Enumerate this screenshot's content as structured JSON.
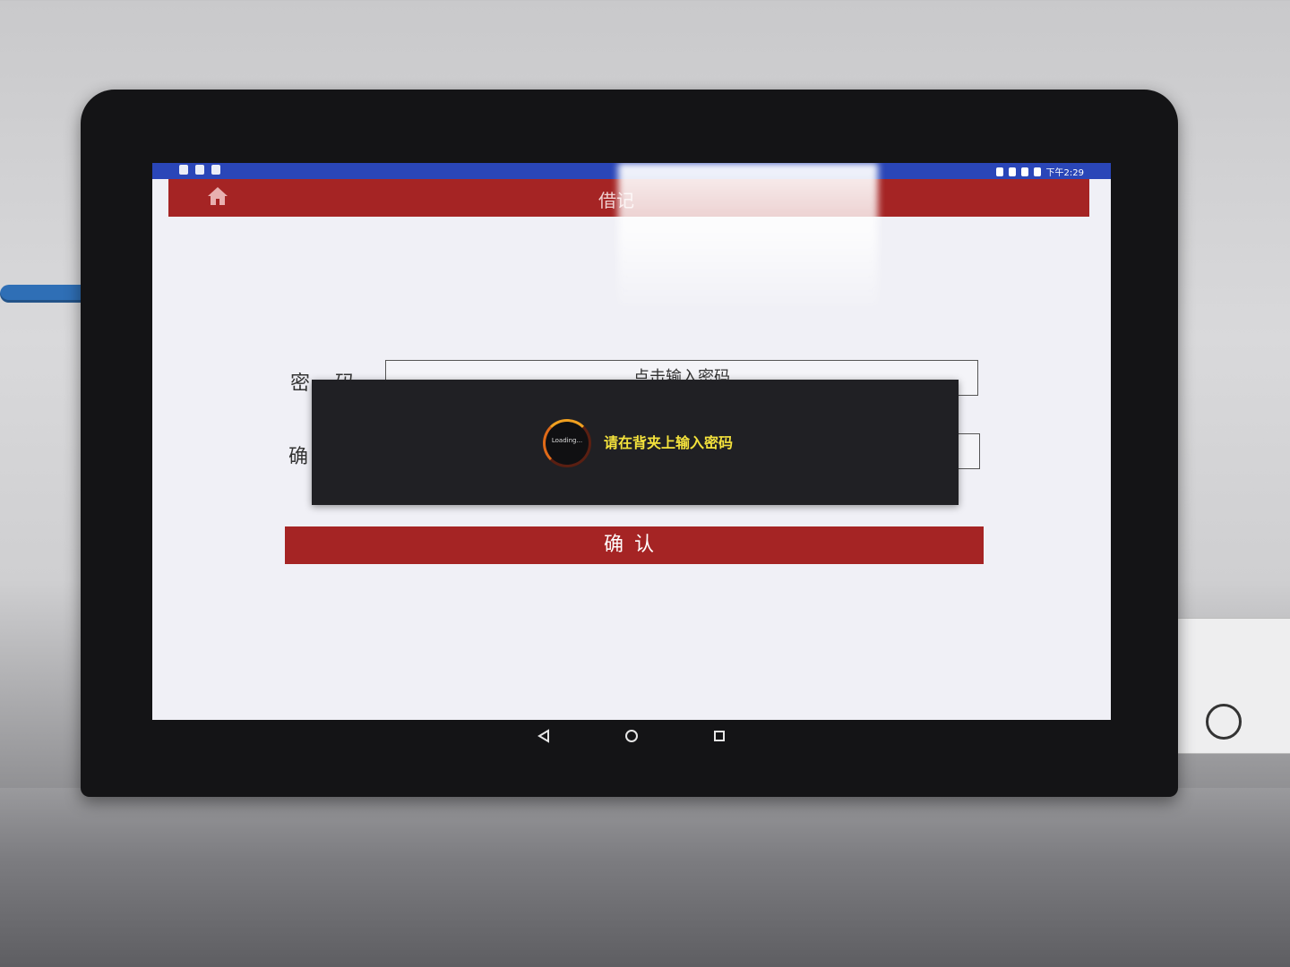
{
  "status_bar": {
    "time": "下午2:29",
    "left_icons": [
      "notification-icon",
      "image-icon",
      "lock-icon"
    ],
    "right_icons": [
      "bluetooth-icon",
      "vibrate-icon",
      "wifi-icon",
      "signal-icon",
      "battery-icon"
    ]
  },
  "app_bar": {
    "title": "借记",
    "home_icon": "home-icon",
    "color": "#a52424"
  },
  "form": {
    "password_label": "密    码",
    "password_placeholder": "点击输入密码",
    "confirm_label": "确",
    "confirm_placeholder": ""
  },
  "confirm_button": {
    "label": "确认"
  },
  "dialog": {
    "spinner_text": "Loading...",
    "message": "请在背夹上输入密码",
    "message_color": "#f4e23c"
  },
  "nav_bar": {
    "buttons": [
      "back-icon",
      "home-circle-icon",
      "recents-icon"
    ]
  }
}
